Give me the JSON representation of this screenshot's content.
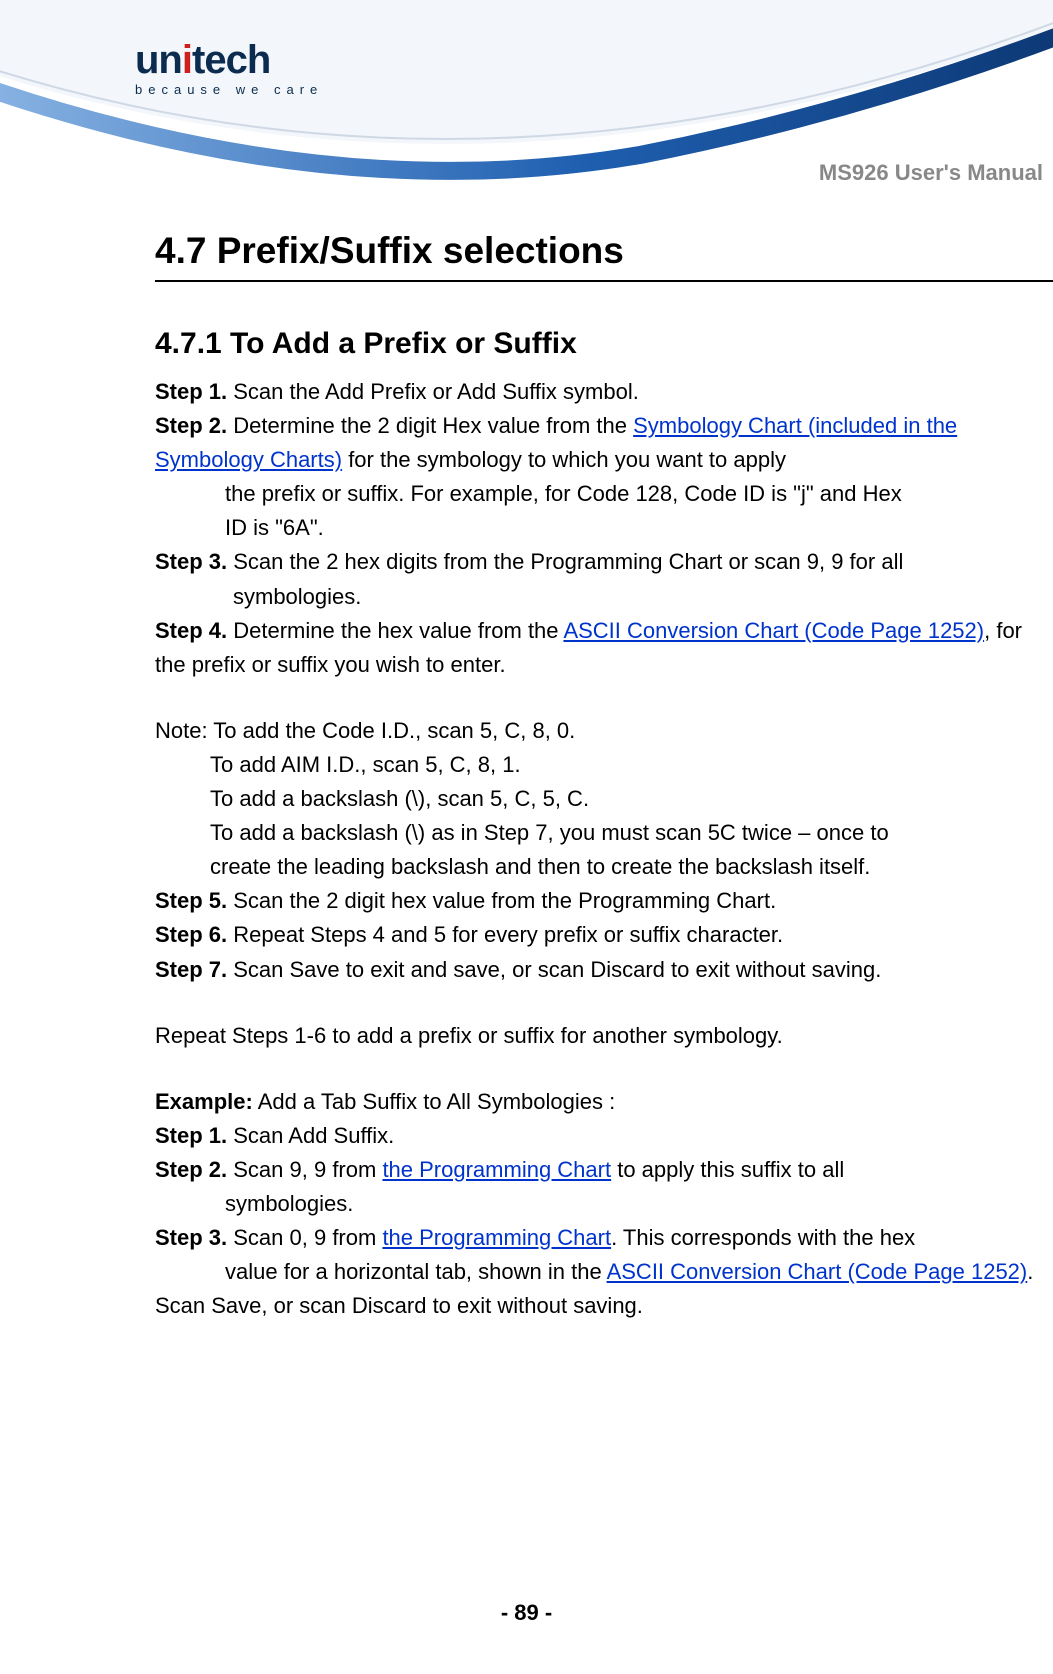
{
  "logo": {
    "word_part1": "un",
    "word_part2": "i",
    "word_part3": "tech",
    "tagline": "because we care"
  },
  "header": {
    "manual_title": "MS926 User's Manual"
  },
  "section": {
    "title": "4.7 Prefix/Suffix selections"
  },
  "subsection": {
    "title": "4.7.1 To Add a Prefix or Suffix"
  },
  "steps_a": {
    "s1": {
      "label": "Step 1.",
      "text": " Scan the Add Prefix or Add Suffix symbol."
    },
    "s2": {
      "label": "Step 2.",
      "pre": " Determine the 2 digit Hex value from the ",
      "link": "Symbology Chart (included in the Symbology Charts)",
      "post1": " for the symbology to which you want to apply ",
      "post2": "the prefix or suffix.    For example, for Code 128, Code ID is \"j\" and Hex ",
      "post3": "ID is \"6A\"."
    },
    "s3": {
      "label": "Step 3.",
      "line1": " Scan the 2 hex digits from the Programming Chart or scan 9, 9 for all",
      "line2": "symbologies."
    },
    "s4": {
      "label": "Step 4.",
      "pre": " Determine the hex value from the ",
      "link": "ASCII Conversion Chart (Code Page 1252)",
      "post": ", for the prefix or suffix you wish to enter."
    }
  },
  "note": {
    "line1": "Note: To add the Code I.D., scan 5, C, 8, 0.",
    "line2": "To add AIM I.D., scan 5, C, 8, 1.",
    "line3": "To add a backslash (\\), scan 5, C, 5, C.",
    "line4": "To add a backslash (\\) as in Step 7, you must scan 5C twice – once to",
    "line5": "create the leading backslash and then to create the backslash itself."
  },
  "steps_b": {
    "s5": {
      "label": "Step 5.",
      "text": " Scan the 2 digit hex value from the Programming Chart."
    },
    "s6": {
      "label": "Step 6.",
      "text": " Repeat Steps 4 and 5 for every prefix or suffix character."
    },
    "s7": {
      "label": "Step 7.",
      "text": " Scan Save to exit and save, or scan Discard to exit without saving."
    }
  },
  "repeat_line": "Repeat Steps 1-6 to add a prefix or suffix for another symbology.",
  "example": {
    "label": "Example:",
    "text": "    Add a Tab Suffix to All Symbologies :"
  },
  "ex_steps": {
    "s1": {
      "label": "Step 1.",
      "text": " Scan Add Suffix."
    },
    "s2": {
      "label": "Step 2.",
      "pre": " Scan 9, 9 from ",
      "link": "the Programming Chart",
      "post1": " to apply this suffix to all ",
      "post2": "symbologies."
    },
    "s3": {
      "label": "Step 3.",
      "pre": " Scan 0, 9 from ",
      "link1": "the Programming Chart",
      "mid1": ". This corresponds with the hex ",
      "mid2": "value for a horizontal tab, shown in the ",
      "link2": "ASCII Conversion Chart (Code Page 1252)",
      "post": "."
    },
    "final": "Scan Save, or scan Discard to exit without saving."
  },
  "page_number": "- 89 -"
}
